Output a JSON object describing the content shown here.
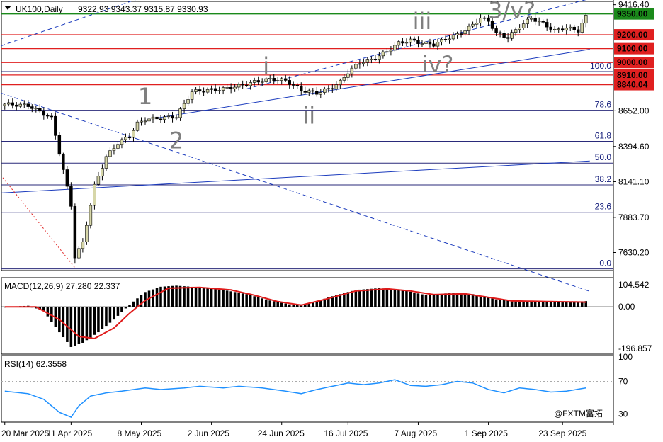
{
  "chart_data": {
    "type": "candlestick",
    "symbol_header": "UK100,Daily",
    "ohlc": [
      "9322.93",
      "9343.37",
      "9315.87",
      "9330.93"
    ],
    "x_axis": {
      "tick_labels": [
        "20 Mar 2025",
        "11 Apr 2025",
        "8 May 2025",
        "2 Jun 2025",
        "24 Jun 2025",
        "16 Jul 2025",
        "7 Aug 2025",
        "1 Sep 2025",
        "23 Sep 2025"
      ]
    },
    "price_axis": {
      "ylim": [
        7500,
        9430
      ],
      "tick_labels": [
        {
          "text": "9416.40",
          "value": 9416.4
        },
        {
          "text": "8652.00",
          "value": 8652.0
        },
        {
          "text": "8394.60",
          "value": 8394.6
        },
        {
          "text": "8141.10",
          "value": 8141.1
        },
        {
          "text": "7883.70",
          "value": 7883.7
        },
        {
          "text": "7630.20",
          "value": 7630.2
        }
      ]
    },
    "level_labels": [
      {
        "text": "9350.00",
        "value": 9350.0,
        "bg": "#1b8a1b"
      },
      {
        "text": "9200.00",
        "value": 9200.0,
        "bg": "#e02020"
      },
      {
        "text": "9100.00",
        "value": 9100.0,
        "bg": "#e02020"
      },
      {
        "text": "9000.00",
        "value": 9000.0,
        "bg": "#e02020"
      },
      {
        "text": "8910.00",
        "value": 8910.0,
        "bg": "#e02020"
      },
      {
        "text": "8840.04",
        "value": 8840.04,
        "bg": "#e02020"
      }
    ],
    "fib_levels": [
      {
        "label": "100.0",
        "value": 8935
      },
      {
        "label": "78.6",
        "value": 8656
      },
      {
        "label": "61.8",
        "value": 8432
      },
      {
        "label": "50.0",
        "value": 8275
      },
      {
        "label": "38.2",
        "value": 8118
      },
      {
        "label": "23.6",
        "value": 7920
      },
      {
        "label": "0.0",
        "value": 7512
      }
    ],
    "wave_labels": [
      "1",
      "2",
      "i",
      "ii",
      "iii",
      "iv?",
      "3/v?"
    ],
    "close_path": [
      [
        0,
        8700
      ],
      [
        6,
        8690
      ],
      [
        12,
        8600
      ],
      [
        14,
        8350
      ],
      [
        17,
        7970
      ],
      [
        18,
        7600
      ],
      [
        20,
        7700
      ],
      [
        23,
        8110
      ],
      [
        26,
        8320
      ],
      [
        29,
        8420
      ],
      [
        32,
        8470
      ],
      [
        34,
        8560
      ],
      [
        36,
        8590
      ],
      [
        40,
        8600
      ],
      [
        44,
        8610
      ],
      [
        48,
        8790
      ],
      [
        52,
        8800
      ],
      [
        56,
        8810
      ],
      [
        60,
        8830
      ],
      [
        64,
        8860
      ],
      [
        68,
        8880
      ],
      [
        72,
        8870
      ],
      [
        76,
        8800
      ],
      [
        80,
        8780
      ],
      [
        84,
        8820
      ],
      [
        86,
        8860
      ],
      [
        88,
        8930
      ],
      [
        91,
        9000
      ],
      [
        94,
        9020
      ],
      [
        98,
        9080
      ],
      [
        101,
        9140
      ],
      [
        104,
        9160
      ],
      [
        107,
        9140
      ],
      [
        110,
        9130
      ],
      [
        113,
        9170
      ],
      [
        116,
        9200
      ],
      [
        119,
        9250
      ],
      [
        122,
        9320
      ],
      [
        124,
        9300
      ],
      [
        126,
        9210
      ],
      [
        129,
        9180
      ],
      [
        132,
        9260
      ],
      [
        135,
        9320
      ],
      [
        138,
        9280
      ],
      [
        141,
        9230
      ],
      [
        144,
        9250
      ],
      [
        147,
        9230
      ],
      [
        149,
        9330
      ]
    ],
    "lows_detail": {
      "min_low": 7550,
      "min_bar": 18
    },
    "macd": {
      "label": "MACD(12,26,9) 27.280 22.337",
      "ylim": [
        -196.857,
        104.542
      ],
      "tick_labels": [
        "104.542",
        "0.00",
        "-196.857"
      ],
      "histogram_path": [
        [
          0,
          0
        ],
        [
          6,
          5
        ],
        [
          10,
          -20
        ],
        [
          14,
          -120
        ],
        [
          17,
          -190
        ],
        [
          20,
          -170
        ],
        [
          24,
          -120
        ],
        [
          28,
          -60
        ],
        [
          32,
          10
        ],
        [
          36,
          70
        ],
        [
          40,
          95
        ],
        [
          44,
          100
        ],
        [
          50,
          92
        ],
        [
          56,
          80
        ],
        [
          62,
          60
        ],
        [
          68,
          30
        ],
        [
          74,
          8
        ],
        [
          78,
          15
        ],
        [
          84,
          50
        ],
        [
          90,
          80
        ],
        [
          96,
          88
        ],
        [
          102,
          80
        ],
        [
          108,
          55
        ],
        [
          114,
          65
        ],
        [
          120,
          60
        ],
        [
          126,
          35
        ],
        [
          132,
          30
        ],
        [
          138,
          25
        ],
        [
          144,
          22
        ],
        [
          149,
          27
        ]
      ],
      "signal_path": [
        [
          0,
          0
        ],
        [
          8,
          0
        ],
        [
          14,
          -60
        ],
        [
          19,
          -140
        ],
        [
          23,
          -150
        ],
        [
          28,
          -100
        ],
        [
          32,
          -30
        ],
        [
          36,
          30
        ],
        [
          42,
          88
        ],
        [
          50,
          92
        ],
        [
          58,
          80
        ],
        [
          64,
          55
        ],
        [
          70,
          25
        ],
        [
          76,
          8
        ],
        [
          82,
          35
        ],
        [
          90,
          75
        ],
        [
          98,
          85
        ],
        [
          104,
          75
        ],
        [
          110,
          58
        ],
        [
          118,
          62
        ],
        [
          124,
          45
        ],
        [
          130,
          28
        ],
        [
          140,
          25
        ],
        [
          149,
          22
        ]
      ],
      "colors": {
        "histogram": "#000000",
        "signal": "#e01b1b"
      }
    },
    "rsi": {
      "label": "RSI(14) 62.3558",
      "ylim": [
        20,
        100
      ],
      "tick_labels": [
        "100",
        "70",
        "30"
      ],
      "levels": [
        70,
        30
      ],
      "path": [
        [
          0,
          58
        ],
        [
          6,
          55
        ],
        [
          10,
          48
        ],
        [
          14,
          32
        ],
        [
          17,
          26
        ],
        [
          19,
          40
        ],
        [
          22,
          52
        ],
        [
          26,
          56
        ],
        [
          30,
          58
        ],
        [
          36,
          62
        ],
        [
          40,
          60
        ],
        [
          46,
          62
        ],
        [
          50,
          64
        ],
        [
          56,
          62
        ],
        [
          60,
          64
        ],
        [
          66,
          62
        ],
        [
          72,
          58
        ],
        [
          76,
          55
        ],
        [
          80,
          60
        ],
        [
          84,
          64
        ],
        [
          88,
          68
        ],
        [
          92,
          66
        ],
        [
          96,
          68
        ],
        [
          100,
          72
        ],
        [
          104,
          65
        ],
        [
          108,
          64
        ],
        [
          112,
          66
        ],
        [
          116,
          70
        ],
        [
          120,
          68
        ],
        [
          124,
          60
        ],
        [
          128,
          56
        ],
        [
          132,
          62
        ],
        [
          136,
          60
        ],
        [
          140,
          57
        ],
        [
          144,
          58
        ],
        [
          149,
          62
        ]
      ],
      "color": "#1e90ff"
    },
    "watermark": "@FXTM富拓",
    "colors": {
      "candle_up_fill": "#d6d6a8",
      "candle_down_fill": "#000000",
      "channel_lines": "#1b3bbd",
      "support_resistance": "#e02020",
      "level_9350": "#1b8a1b"
    }
  }
}
